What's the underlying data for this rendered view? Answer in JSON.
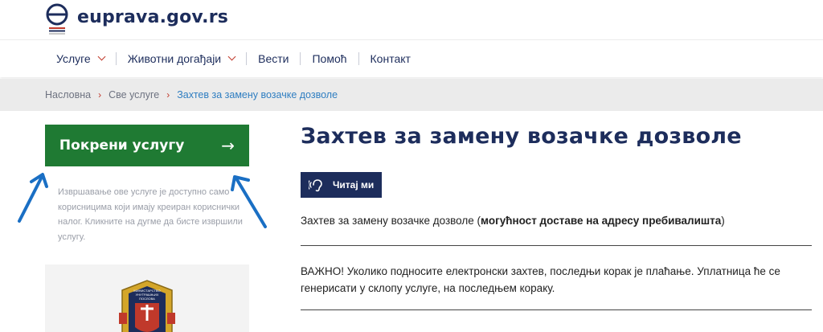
{
  "header": {
    "logo_text": "euprava.gov.rs"
  },
  "nav": {
    "items": [
      {
        "label": "Услуге",
        "dropdown": true
      },
      {
        "label": "Животни догађаји",
        "dropdown": true
      },
      {
        "label": "Вести",
        "dropdown": false
      },
      {
        "label": "Помоћ",
        "dropdown": false
      },
      {
        "label": "Контакт",
        "dropdown": false
      }
    ]
  },
  "breadcrumb": {
    "items": [
      "Насловна",
      "Све услуге",
      "Захтев за замену возачке дозволе"
    ]
  },
  "sidebar": {
    "start_button": "Покрени услугу",
    "start_arrow": "→",
    "note": "Извршавање ове услуге је доступно само корисницима који имају креиран кориснички налог. Кликните на дугме да бисте извршили услугу.",
    "emblem_text": "МИНИСТАРСТВО УНУТРАШЊИХ ПОСЛОВА"
  },
  "main": {
    "title": "Захтев за замену возачке дозволе",
    "read_button": "Читај ми",
    "para1_prefix": "Захтев за замену возачке дозволе (",
    "para1_bold": "могућност доставе на адресу пребивалишта",
    "para1_suffix": ")",
    "para2": "ВАЖНО! Уколико подносите електронски захтев, последњи корак је плаћање. Уплатница ће се генерисати у склопу услуге, на последњем кораку."
  },
  "colors": {
    "navy": "#1d2d5c",
    "green": "#1f7a33",
    "accent_red": "#c0392b",
    "link_blue": "#2f7ec1",
    "annotation_blue": "#1a6fc4"
  }
}
